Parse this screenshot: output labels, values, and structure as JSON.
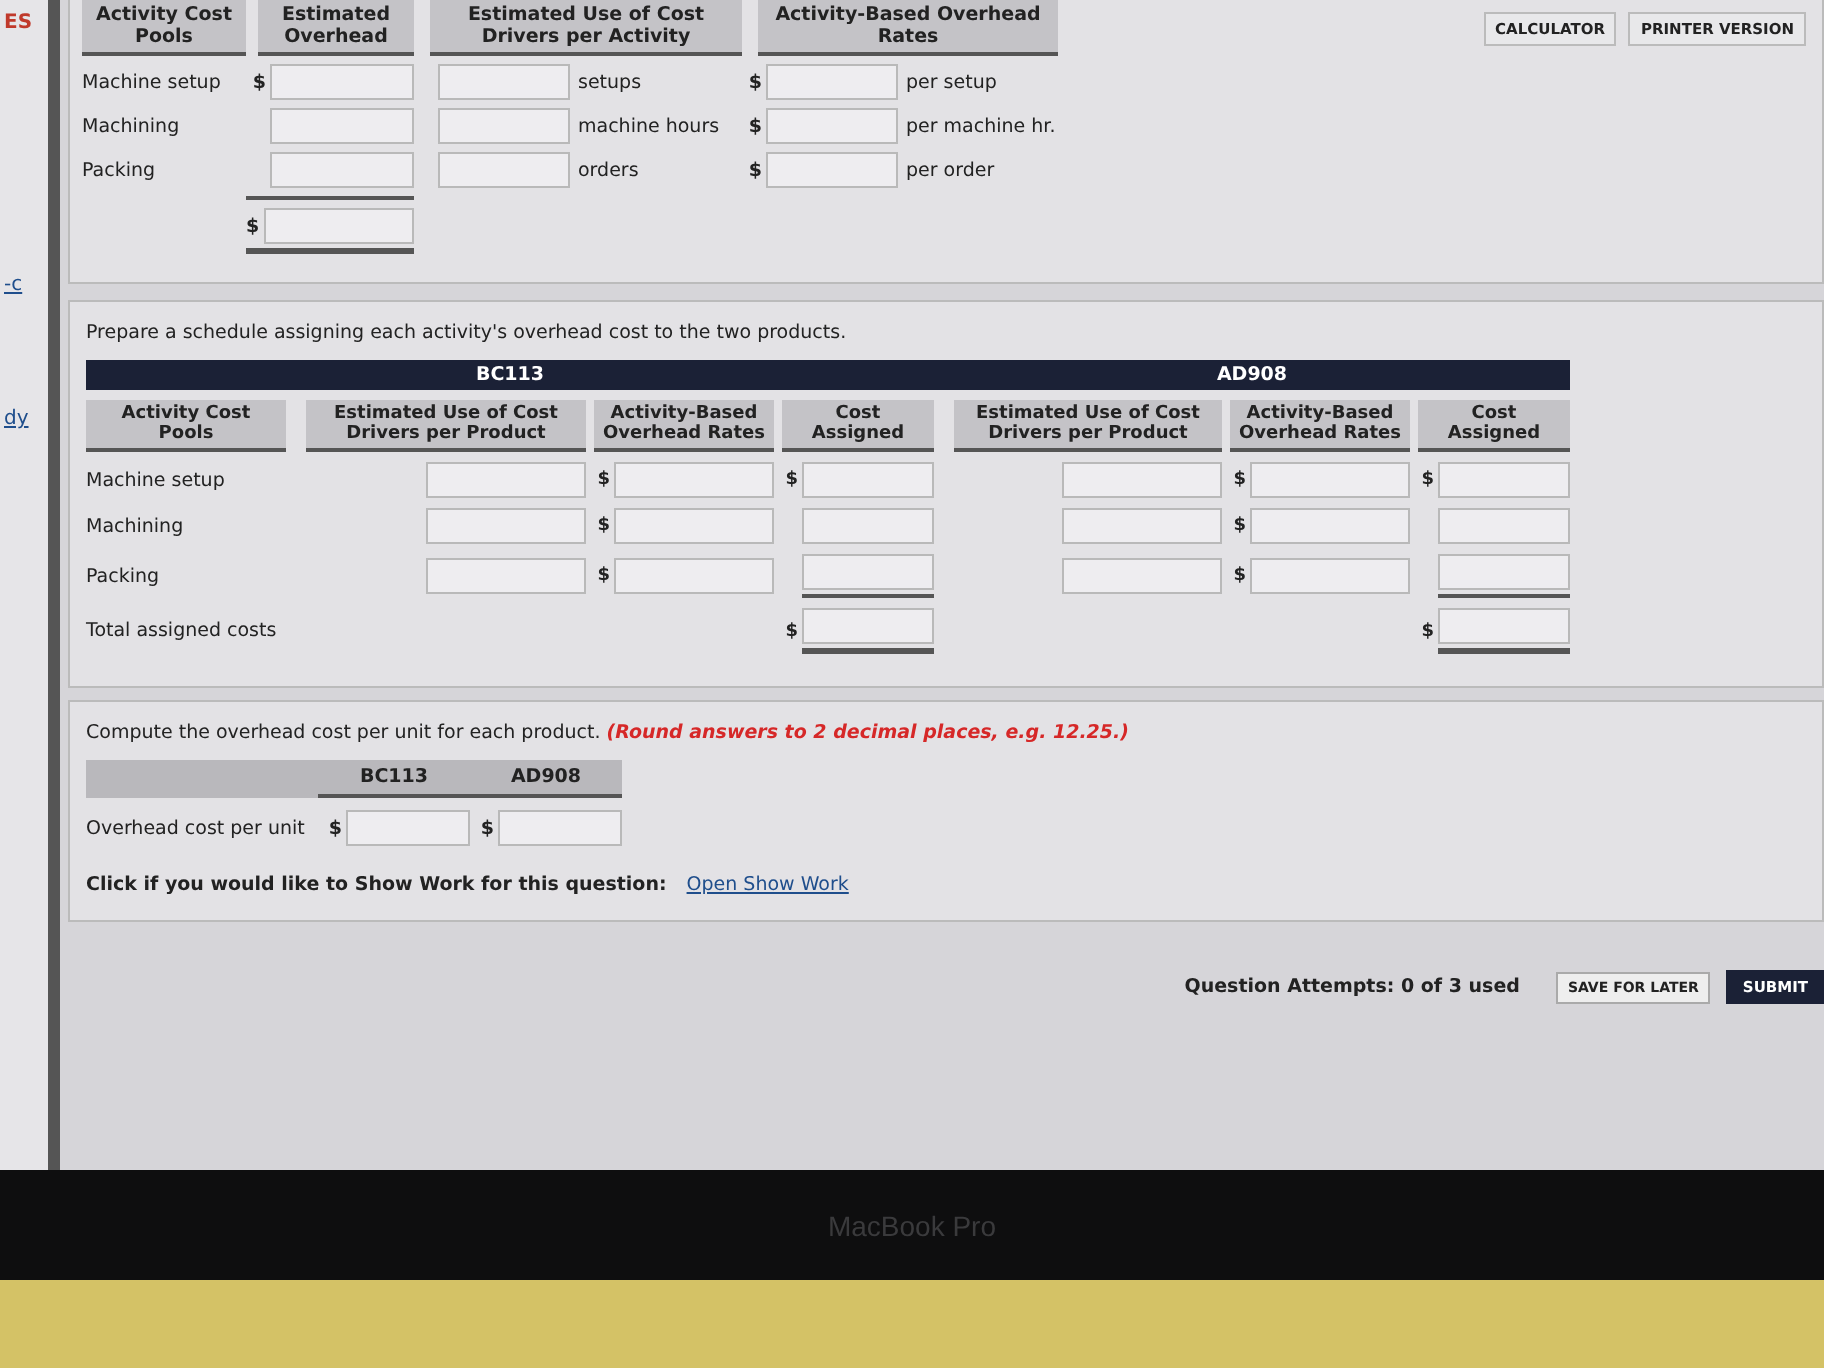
{
  "sidebar": {
    "items": [
      {
        "text": "ES",
        "kind": "alert"
      },
      {
        "text": "-c",
        "kind": "link"
      },
      {
        "text": "dy",
        "kind": "link"
      }
    ]
  },
  "toolbar": {
    "buttons": [
      "CALCULATOR",
      "PRINTER VERSION"
    ]
  },
  "rates_table": {
    "columns": [
      "Activity Cost Pools",
      "Estimated Overhead",
      "Estimated Use of Cost Drivers per Activity",
      "Activity-Based Overhead Rates"
    ],
    "rows": [
      {
        "pool": "Machine setup",
        "overhead_currency": "$",
        "driver_unit": "setups",
        "rate_currency": "$",
        "rate_unit": "per setup"
      },
      {
        "pool": "Machining",
        "driver_unit": "machine hours",
        "rate_currency": "$",
        "rate_unit": "per machine hr."
      },
      {
        "pool": "Packing",
        "driver_unit": "orders",
        "rate_currency": "$",
        "rate_unit": "per order"
      }
    ],
    "total_currency": "$"
  },
  "schedule": {
    "instruction": "Prepare a schedule assigning each activity's overhead cost to the two products.",
    "pool_column": "Activity Cost Pools",
    "pools": [
      "Machine setup",
      "Machining",
      "Packing"
    ],
    "total_label": "Total assigned costs",
    "products": [
      {
        "name": "BC113",
        "columns": [
          "Estimated Use of Cost Drivers per Product",
          "Activity-Based Overhead Rates",
          "Cost Assigned"
        ],
        "rows": [
          {
            "rate_currency": "$",
            "cost_currency": "$"
          },
          {
            "rate_currency": "$"
          },
          {
            "rate_currency": "$"
          }
        ],
        "total_currency": "$"
      },
      {
        "name": "AD908",
        "columns": [
          "Estimated Use of Cost Drivers per Product",
          "Activity-Based Overhead Rates",
          "Cost Assigned"
        ],
        "rows": [
          {
            "rate_currency": "$",
            "cost_currency": "$"
          },
          {
            "rate_currency": "$"
          },
          {
            "rate_currency": "$"
          }
        ],
        "total_currency": "$"
      }
    ]
  },
  "per_unit": {
    "instruction": "Compute the overhead cost per unit for each product.",
    "note": "(Round answers to 2 decimal places, e.g. 12.25.)",
    "columns": [
      "BC113",
      "AD908"
    ],
    "row_label": "Overhead cost per unit",
    "currencies": [
      "$",
      "$"
    ],
    "show_work": {
      "prompt": "Click if you would like to Show Work for this question:",
      "link": "Open Show Work"
    }
  },
  "footer": {
    "attempts": "Question Attempts: 0 of 3 used",
    "buttons": [
      {
        "label": "SAVE FOR LATER",
        "kind": "secondary"
      },
      {
        "label": "SUBMIT",
        "kind": "primary"
      }
    ]
  },
  "laptop": {
    "label": "MacBook Pro"
  }
}
